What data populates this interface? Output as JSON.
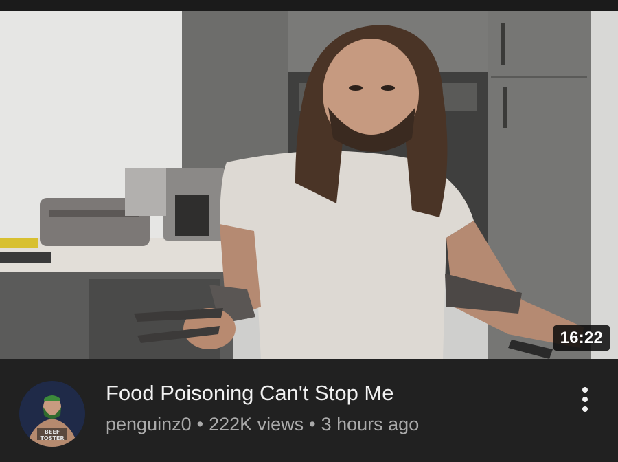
{
  "video": {
    "duration": "16:22",
    "title": "Food Poisoning Can't Stop Me",
    "channel": "penguinz0",
    "views": "222K views",
    "age": "3 hours ago",
    "separator": "•"
  },
  "avatar": {
    "text": "BEEF\nTOSTER"
  },
  "icons": {
    "more": "more-vert-icon"
  },
  "colors": {
    "background": "#212121",
    "title": "#f1f1f1",
    "secondary_text": "#aaaaaa",
    "duration_badge": "#0a0a0a"
  }
}
